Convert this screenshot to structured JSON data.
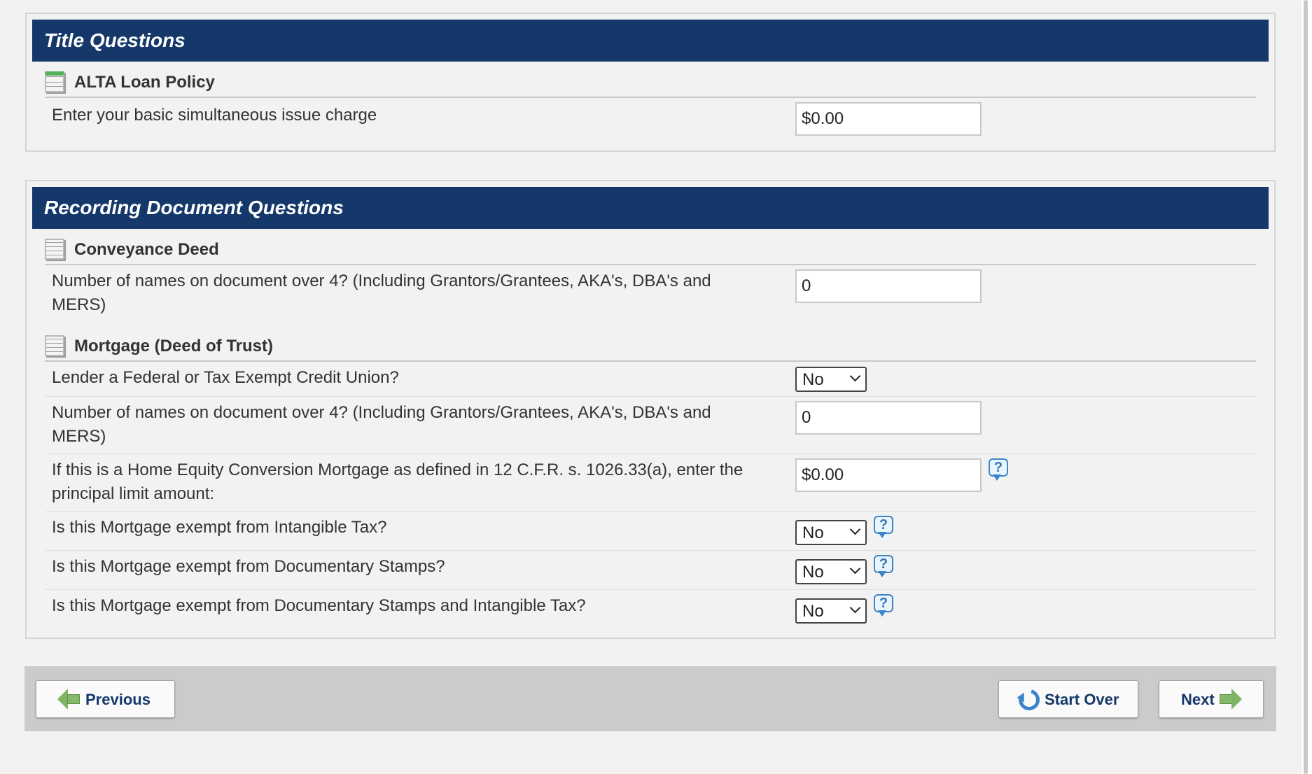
{
  "title_questions": {
    "header": "Title Questions",
    "group": "ALTA Loan Policy",
    "rows": [
      {
        "label": "Enter your basic simultaneous issue charge",
        "value": "$0.00"
      }
    ]
  },
  "recording_questions": {
    "header": "Recording Document Questions",
    "conveyance": {
      "group": "Conveyance Deed",
      "names_label": "Number of names on document over 4? (Including Grantors/Grantees, AKA's, DBA's and MERS)",
      "names_value": "0"
    },
    "mortgage": {
      "group": "Mortgage (Deed of Trust)",
      "lender_label": "Lender a Federal or Tax Exempt Credit Union?",
      "lender_value": "No",
      "names_label": "Number of names on document over 4? (Including Grantors/Grantees, AKA's, DBA's and MERS)",
      "names_value": "0",
      "hecm_label": "If this is a Home Equity Conversion Mortgage as defined in 12 C.F.R. s. 1026.33(a), enter the principal limit amount:",
      "hecm_value": "$0.00",
      "intangible_label": "Is this Mortgage exempt from Intangible Tax?",
      "intangible_value": "No",
      "stamps_label": "Is this Mortgage exempt from Documentary Stamps?",
      "stamps_value": "No",
      "both_label": "Is this Mortgage exempt from Documentary Stamps and Intangible Tax?",
      "both_value": "No"
    }
  },
  "help_glyph": "?",
  "footer": {
    "previous_label": "Previous",
    "start_over_label": "Start Over",
    "next_label": "Next"
  },
  "colors": {
    "header_bg": "#15386a",
    "page_bg": "#f2f2f2",
    "footer_bg": "#cbcbcb",
    "button_text": "#15386a"
  },
  "icons": [
    "document-icon",
    "help-icon",
    "arrow-left-icon",
    "arrow-right-icon",
    "refresh-icon"
  ]
}
